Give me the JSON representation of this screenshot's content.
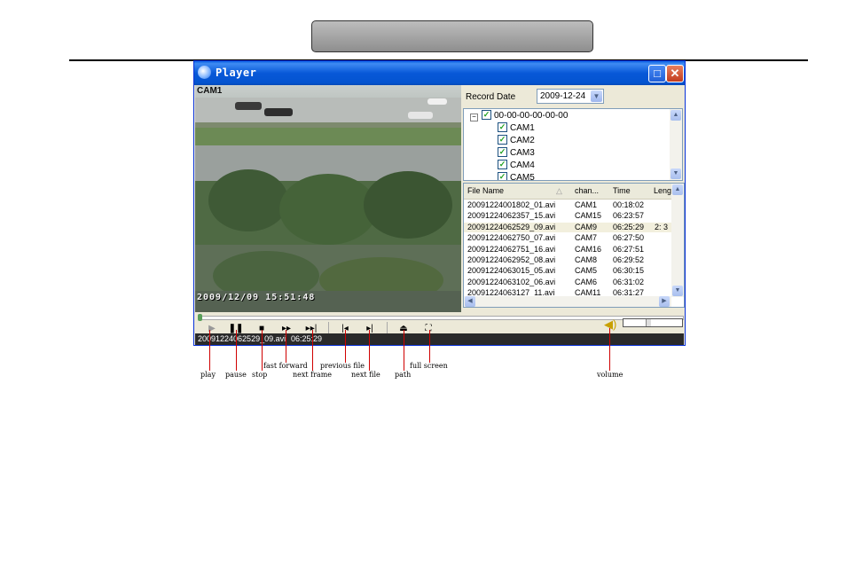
{
  "window": {
    "title": "Player"
  },
  "video": {
    "camera_label": "CAM1",
    "osd_timestamp": "2009/12/09 15:51:48"
  },
  "record_date": {
    "label": "Record Date",
    "value": "2009-12-24"
  },
  "tree": {
    "root": "00-00-00-00-00-00",
    "cameras": [
      "CAM1",
      "CAM2",
      "CAM3",
      "CAM4",
      "CAM5"
    ]
  },
  "file_list": {
    "columns": [
      "File Name",
      "chan...",
      "Time",
      "Leng"
    ],
    "rows": [
      {
        "file": "20091224001802_01.avi",
        "chan": "CAM1",
        "time": "00:18:02",
        "len": ""
      },
      {
        "file": "20091224062357_15.avi",
        "chan": "CAM15",
        "time": "06:23:57",
        "len": ""
      },
      {
        "file": "20091224062529_09.avi",
        "chan": "CAM9",
        "time": "06:25:29",
        "len": "2: 3"
      },
      {
        "file": "20091224062750_07.avi",
        "chan": "CAM7",
        "time": "06:27:50",
        "len": ""
      },
      {
        "file": "20091224062751_16.avi",
        "chan": "CAM16",
        "time": "06:27:51",
        "len": ""
      },
      {
        "file": "20091224062952_08.avi",
        "chan": "CAM8",
        "time": "06:29:52",
        "len": ""
      },
      {
        "file": "20091224063015_05.avi",
        "chan": "CAM5",
        "time": "06:30:15",
        "len": ""
      },
      {
        "file": "20091224063102_06.avi",
        "chan": "CAM6",
        "time": "06:31:02",
        "len": ""
      },
      {
        "file": "20091224063127_11.avi",
        "chan": "CAM11",
        "time": "06:31:27",
        "len": ""
      }
    ]
  },
  "status": {
    "file": "20091224062529_09.avi",
    "time": "06:25:29"
  },
  "annotations": {
    "play": "play",
    "pause": "pause",
    "stop": "stop",
    "fast_forward": "fast forward",
    "next_frame": "next frame",
    "previous_file": "previous file",
    "next_file": "next file",
    "path": "path",
    "full_screen": "full screen",
    "volume": "volume"
  },
  "colors": {
    "titlebar": "#0A5FE0",
    "annotation_line": "#d00000",
    "window_bg": "#ECE9D8"
  }
}
